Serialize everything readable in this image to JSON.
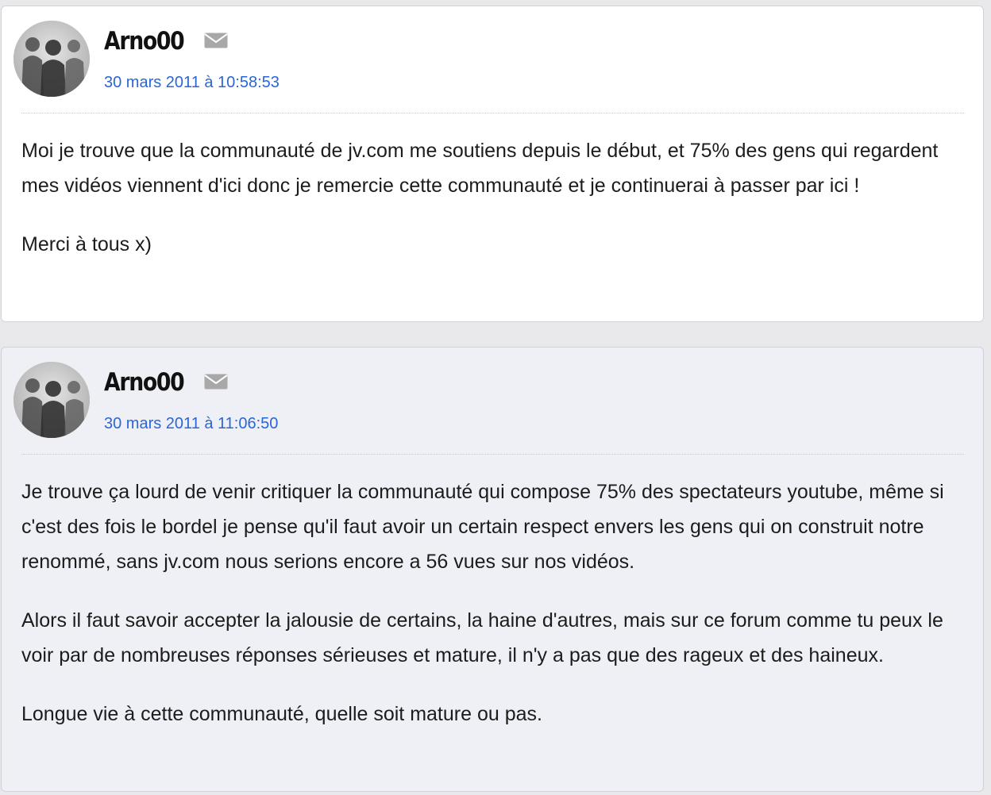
{
  "posts": [
    {
      "author": "Arno00",
      "date": "30 mars 2011 à 10:58:53",
      "paragraphs": [
        "Moi je trouve que la communauté de jv.com me soutiens depuis le début, et 75% des gens qui regardent mes vidéos viennent d'ici donc je remercie cette communauté et je continuerai à passer par ici !",
        "Merci à tous x)"
      ]
    },
    {
      "author": "Arno00",
      "date": "30 mars 2011 à 11:06:50",
      "paragraphs": [
        "Je trouve ça lourd de venir critiquer la communauté qui compose 75% des spectateurs youtube, même si c'est des fois le bordel je pense qu'il faut avoir un certain respect envers les gens qui on construit notre renommé, sans jv.com nous serions encore a 56 vues sur nos vidéos.",
        "Alors il faut savoir accepter la jalousie de certains, la haine d'autres, mais sur ce forum comme tu peux le voir par de nombreuses réponses sérieuses et mature, il n'y a pas que des rageux et des haineux.",
        "Longue vie à cette communauté, quelle soit mature ou pas."
      ]
    }
  ],
  "icons": {
    "message": "envelope-icon",
    "avatar": "avatar-silhouettes"
  },
  "colors": {
    "date_link": "#2a66d6",
    "post2_bg": "#eff0f5"
  }
}
